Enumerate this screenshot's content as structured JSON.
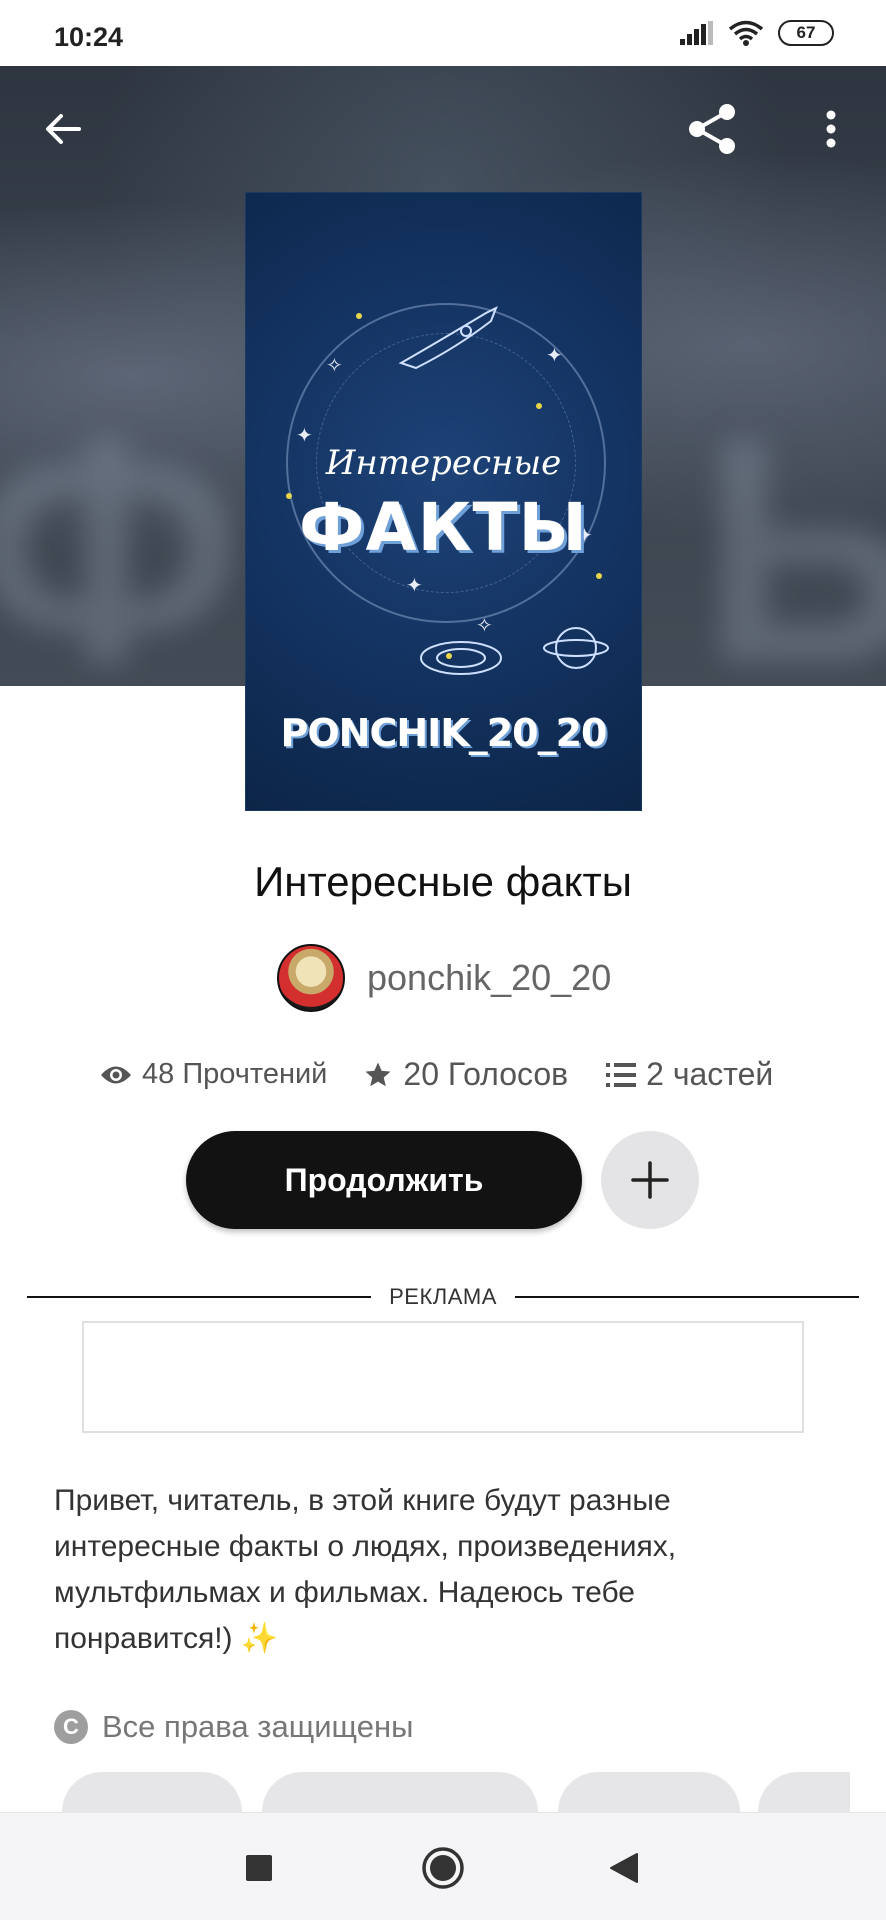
{
  "status_bar": {
    "time": "10:24",
    "battery": "67",
    "icons": [
      "signal-icon",
      "wifi-icon",
      "battery-icon"
    ]
  },
  "top_bar": {
    "back_icon": "arrow-left-icon",
    "share_icon": "share-icon",
    "more_icon": "more-vert-icon"
  },
  "cover": {
    "subtitle": "Интересные",
    "title": "ФАКТЫ",
    "author": "PONCHIK_20_20",
    "background_color": "#0f2a4f"
  },
  "book": {
    "title": "Интересные факты",
    "author": "ponchik_20_20"
  },
  "stats": {
    "reads": "48 Прочтений",
    "votes": "20 Голосов",
    "parts": "2 частей"
  },
  "actions": {
    "continue_label": "Продолжить",
    "add_icon": "plus-icon"
  },
  "ad": {
    "label": "РЕКЛАМА"
  },
  "description": {
    "text": "Привет, читатель, в этой книге будут разные интересные факты о людях, произведениях, мультфильмах и фильмах. Надеюсь тебе понравится!)",
    "emoji": "✨"
  },
  "copyright": {
    "icon_letter": "C",
    "text": "Все права защищены"
  },
  "navbar": {
    "icons": [
      "recents-square-icon",
      "home-circle-icon",
      "back-triangle-icon"
    ]
  },
  "colors": {
    "primary_button": "#121212",
    "secondary_button": "#e4e3e6",
    "muted_text": "#777777"
  }
}
